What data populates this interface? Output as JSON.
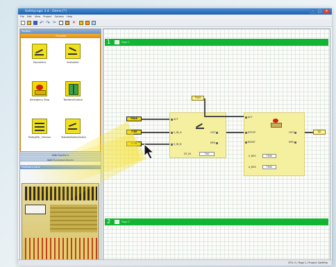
{
  "window": {
    "title": "SafetyLogic 3.4 - Demo [*]",
    "menu": [
      "File",
      "Edit",
      "View",
      "Project",
      "Options",
      "Help"
    ],
    "toolbar_icons": [
      "new-icon",
      "open-icon",
      "save-icon",
      "undo-icon",
      "redo-icon",
      "cut-icon",
      "copy-icon",
      "paste-icon",
      "delete-icon",
      "compile-icon",
      "download-icon",
      "monitor-icon"
    ]
  },
  "left_panel": {
    "header": "Toolbox",
    "functions_header": "Function",
    "functions": [
      {
        "label": "Equivalent",
        "icon": "equivalent-switch-icon"
      },
      {
        "label": "Antivalent",
        "icon": "antivalent-switch-icon"
      },
      {
        "label": "Emergency Stop",
        "icon": "emergency-stop-icon"
      },
      {
        "label": "TwoHandControl",
        "icon": "two-hand-control-icon"
      },
      {
        "label": "MutingPar_2Sensor",
        "icon": "muting-icon"
      },
      {
        "label": "TestableSafetySwitch",
        "icon": "testable-switch-icon"
      }
    ],
    "tabs": [
      "Safe Functions",
      "Safe Functional Blocks"
    ],
    "hardware_header": "Hardware pane"
  },
  "canvas": {
    "page1": {
      "number": "1",
      "name": "Page 1"
    },
    "page2": {
      "number": "2",
      "name": "Page 2"
    },
    "tags": {
      "true_top": "TRUE",
      "in_a": "TRUE",
      "in_b": "E-IN",
      "in_c": "E-IN",
      "out": "Q0"
    },
    "block1": {
      "pins_in": [
        "ACT",
        "S_IN_A",
        "S_IN_B"
      ],
      "pins_out": [
        "OUT",
        "ERR"
      ],
      "param_label": "DT_IN",
      "param_value": "T#0"
    },
    "block2": {
      "pins_in": [
        "ACT",
        "ESTOP",
        "RESET"
      ],
      "pins_out": [
        "OUT",
        "ERR"
      ],
      "params": [
        {
          "label": "S_RES",
          "value": "TRUE"
        },
        {
          "label": "A_RES",
          "value": "TRUE"
        }
      ]
    }
  },
  "status_bar": {
    "text": "CPU: 0 | Page 1 | Project: SafeProj"
  }
}
